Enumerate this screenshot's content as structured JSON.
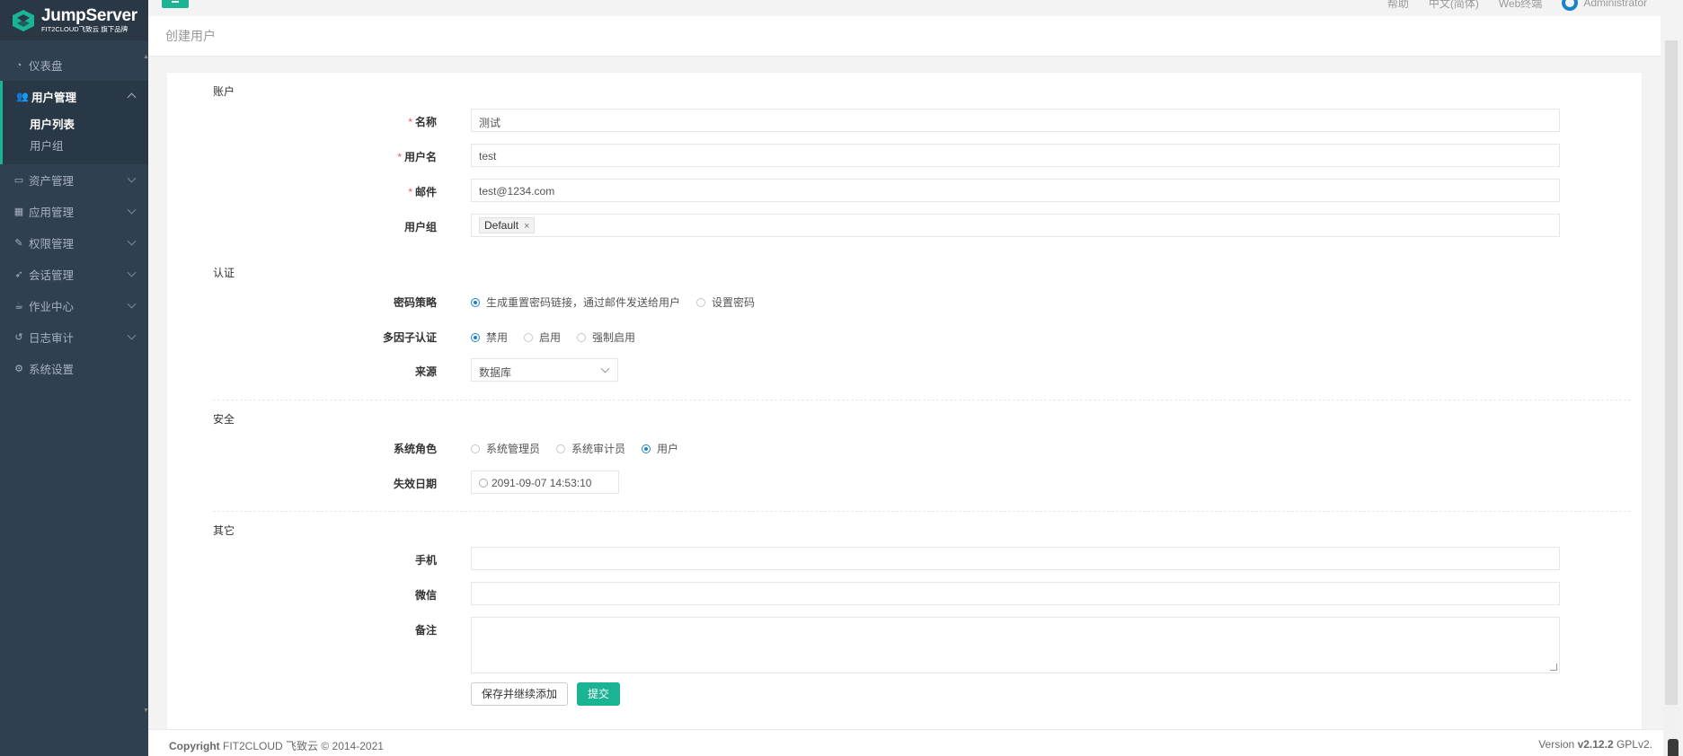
{
  "brand": {
    "name": "JumpServer",
    "tagline": "FIT2CLOUD飞致云 旗下品牌"
  },
  "topbar": {
    "items": [
      "帮助",
      "中文(简体)",
      "Web终端",
      "Administrator"
    ]
  },
  "sidebar": {
    "items": [
      {
        "label": "仪表盘",
        "icon": "dashboard-icon"
      },
      {
        "label": "用户管理",
        "icon": "users-icon",
        "active": true,
        "children": [
          {
            "label": "用户列表",
            "current": true
          },
          {
            "label": "用户组"
          }
        ]
      },
      {
        "label": "资产管理",
        "icon": "inbox-icon"
      },
      {
        "label": "应用管理",
        "icon": "grid-icon"
      },
      {
        "label": "权限管理",
        "icon": "edit-icon"
      },
      {
        "label": "会话管理",
        "icon": "rocket-icon"
      },
      {
        "label": "作业中心",
        "icon": "coffee-icon"
      },
      {
        "label": "日志审计",
        "icon": "history-icon"
      },
      {
        "label": "系统设置",
        "icon": "gears-icon"
      }
    ]
  },
  "page": {
    "title": "创建用户"
  },
  "form": {
    "sections": {
      "account": "账户",
      "auth": "认证",
      "security": "安全",
      "other": "其它"
    },
    "name": {
      "label": "名称",
      "value": "测试"
    },
    "username": {
      "label": "用户名",
      "value": "test"
    },
    "email": {
      "label": "邮件",
      "value": "test@1234.com"
    },
    "groups": {
      "label": "用户组",
      "tags": [
        "Default"
      ]
    },
    "password_strategy": {
      "label": "密码策略",
      "options": [
        "生成重置密码链接，通过邮件发送给用户",
        "设置密码"
      ],
      "selected": 0
    },
    "mfa": {
      "label": "多因子认证",
      "options": [
        "禁用",
        "启用",
        "强制启用"
      ],
      "selected": 0
    },
    "source": {
      "label": "来源",
      "value": "数据库"
    },
    "system_role": {
      "label": "系统角色",
      "options": [
        "系统管理员",
        "系统审计员",
        "用户"
      ],
      "selected": 2
    },
    "expire": {
      "label": "失效日期",
      "value": "2091-09-07 14:53:10"
    },
    "phone": {
      "label": "手机",
      "value": ""
    },
    "wechat": {
      "label": "微信",
      "value": ""
    },
    "comment": {
      "label": "备注",
      "value": ""
    },
    "buttons": {
      "save_continue": "保存并继续添加",
      "submit": "提交"
    }
  },
  "footer": {
    "copyright_bold": "Copyright",
    "copyright": "FIT2CLOUD 飞致云 © 2014-2021",
    "version_prefix": "Version",
    "version": "v2.12.2",
    "license": "GPLv2."
  },
  "colors": {
    "sidebar_bg": "#2f4050",
    "primary": "#1ab394",
    "radio": "#1c84c6",
    "required": "#ed5565"
  }
}
